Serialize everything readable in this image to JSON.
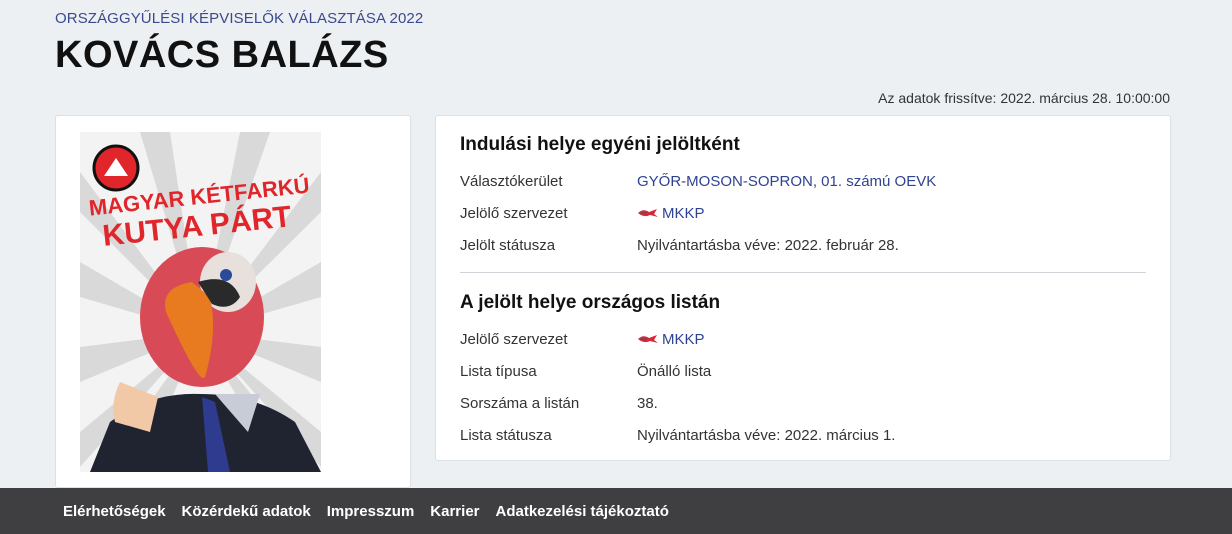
{
  "header": {
    "election_title": "Országgyűlési képviselők választása 2022",
    "candidate_name": "KOVÁCS BALÁZS",
    "updated": "Az adatok frissítve: 2022. március 28. 10:00:00"
  },
  "photo": {
    "poster_line1": "MAGYAR KÉTFARKÚ",
    "poster_line2": "KUTYA PÁRT",
    "accent_color": "#e0262b"
  },
  "individual": {
    "title": "Indulási helye egyéni jelöltként",
    "rows": [
      {
        "label": "Választókerület",
        "value": "GYŐR-MOSON-SOPRON, 01. számú OEVK"
      },
      {
        "label": "Jelölő szervezet",
        "value": "MKKP"
      },
      {
        "label": "Jelölt státusza",
        "value": "Nyilvántartásba véve: 2022. február 28."
      }
    ]
  },
  "national": {
    "title": "A jelölt helye országos listán",
    "rows": [
      {
        "label": "Jelölő szervezet",
        "value": "MKKP"
      },
      {
        "label": "Lista típusa",
        "value": "Önálló lista"
      },
      {
        "label": "Sorszáma a listán",
        "value": "38."
      },
      {
        "label": "Lista státusza",
        "value": "Nyilvántartásba véve: 2022. március 1."
      }
    ]
  },
  "footer": {
    "links": [
      "Elérhetőségek",
      "Közérdekű adatok",
      "Impresszum",
      "Karrier",
      "Adatkezelési tájékoztató"
    ]
  },
  "colors": {
    "link": "#2e4391",
    "footer_bg": "#3f3f41",
    "page_bg": "#edf0f3"
  }
}
